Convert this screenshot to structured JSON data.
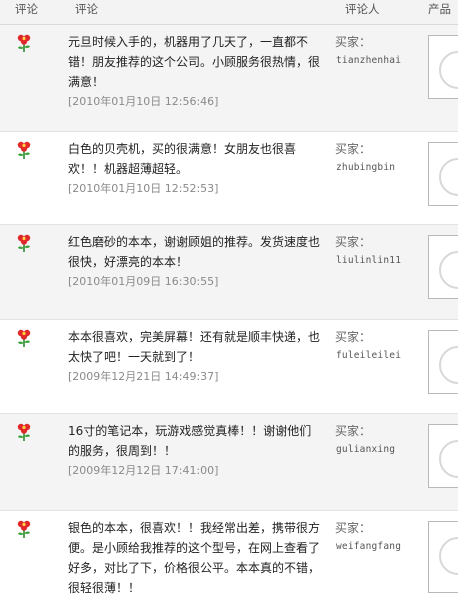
{
  "header": {
    "rating": "评论",
    "comment": "评论",
    "reviewer": "评论人",
    "product": "产品"
  },
  "reviews": [
    {
      "text": "元旦时候入手的，机器用了几天了，一直都不错！朋友推荐的这个公司。小顾服务很热情，很满意！",
      "date": "[2010年01月10日 12:56:46]",
      "buyer_label": "买家：",
      "buyer_name": "tianzhenhai"
    },
    {
      "text": "白色的贝壳机，买的很满意！女朋友也很喜欢！！机器超薄超轻。",
      "date": "[2010年01月10日 12:52:53]",
      "buyer_label": "买家：",
      "buyer_name": "zhubingbin"
    },
    {
      "text": "红色磨砂的本本，谢谢顾姐的推荐。发货速度也很快，好漂亮的本本！",
      "date": "[2010年01月09日 16:30:55]",
      "buyer_label": "买家：",
      "buyer_name": "liulinlin11"
    },
    {
      "text": "本本很喜欢，完美屏幕！还有就是顺丰快递，也太快了吧！一天就到了！",
      "date": "[2009年12月21日 14:49:37]",
      "buyer_label": "买家：",
      "buyer_name": "fuleileilei"
    },
    {
      "text": "16寸的笔记本，玩游戏感觉真棒！！谢谢他们的服务，很周到！！",
      "date": "[2009年12月12日 17:41:00]",
      "buyer_label": "买家：",
      "buyer_name": "gulianxing"
    },
    {
      "text": "银色的本本，很喜欢！！我经常出差，携带很方便。是小顾给我推荐的这个型号，在网上查看了好多，对比了下，价格很公平。本本真的不错，很轻很薄！！",
      "date": "",
      "buyer_label": "买家：",
      "buyer_name": "weifangfang"
    }
  ]
}
